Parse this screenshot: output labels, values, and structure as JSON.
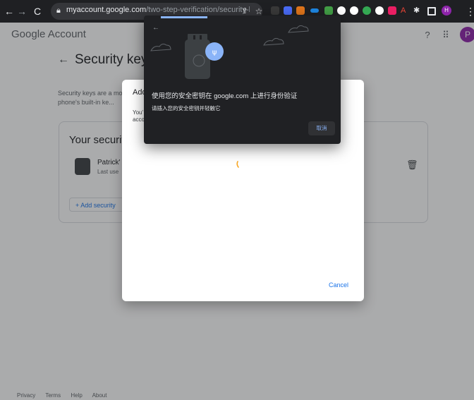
{
  "browser": {
    "url_host": "myaccount.google.com",
    "url_path": "/two-step-verification/security-k...",
    "profile_initial": "H"
  },
  "header": {
    "logo_google": "Google",
    "logo_account": "Account",
    "avatar_initial": "P"
  },
  "page": {
    "title": "Security keys",
    "intro": "Security keys are a more se... use your phone's built-in ke...",
    "card_title": "Your securit",
    "key_name": "Patrick'",
    "key_sub": "Last use",
    "add_key_label": "+  Add security"
  },
  "footer": {
    "links": [
      "Privacy",
      "Terms",
      "Help",
      "About"
    ]
  },
  "dialog": {
    "title": "Add",
    "body": "You' account",
    "cancel": "Cancel"
  },
  "webauthn": {
    "title": "使用您的安全密钥在 google.com 上进行身份验证",
    "subtitle": "请插入您的安全密钥并轻触它",
    "cancel": "取消"
  },
  "colors": {
    "accent": "#1a73e8",
    "chrome_bg": "#1f2023",
    "prompt_bg": "#202124",
    "prompt_progress": "#8ab4f8",
    "avatar": "#8e24aa"
  }
}
